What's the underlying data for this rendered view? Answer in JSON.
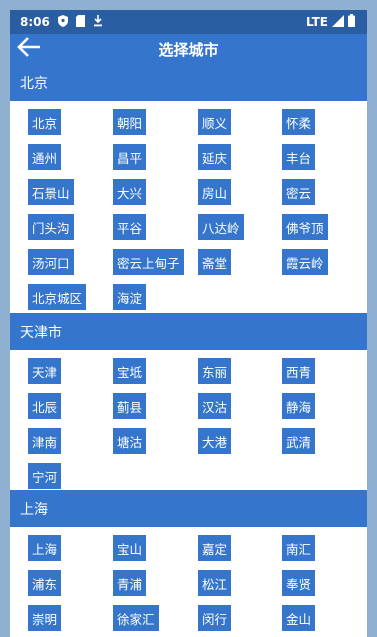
{
  "status_bar": {
    "time": "8:06",
    "network": "LTE"
  },
  "app_bar": {
    "title": "选择城市"
  },
  "sections": [
    {
      "name": "北京",
      "cities": [
        "北京",
        "朝阳",
        "顺义",
        "怀柔",
        "通州",
        "昌平",
        "延庆",
        "丰台",
        "石景山",
        "大兴",
        "房山",
        "密云",
        "门头沟",
        "平谷",
        "八达岭",
        "佛爷顶",
        "汤河口",
        "密云上甸子",
        "斋堂",
        "霞云岭",
        "北京城区",
        "海淀"
      ]
    },
    {
      "name": "天津市",
      "cities": [
        "天津",
        "宝坻",
        "东丽",
        "西青",
        "北辰",
        "蓟县",
        "汉沽",
        "静海",
        "津南",
        "塘沽",
        "大港",
        "武清",
        "宁河"
      ]
    },
    {
      "name": "上海",
      "cities": [
        "上海",
        "宝山",
        "嘉定",
        "南汇",
        "浦东",
        "青浦",
        "松江",
        "奉贤",
        "崇明",
        "徐家汇",
        "闵行",
        "金山"
      ]
    }
  ]
}
